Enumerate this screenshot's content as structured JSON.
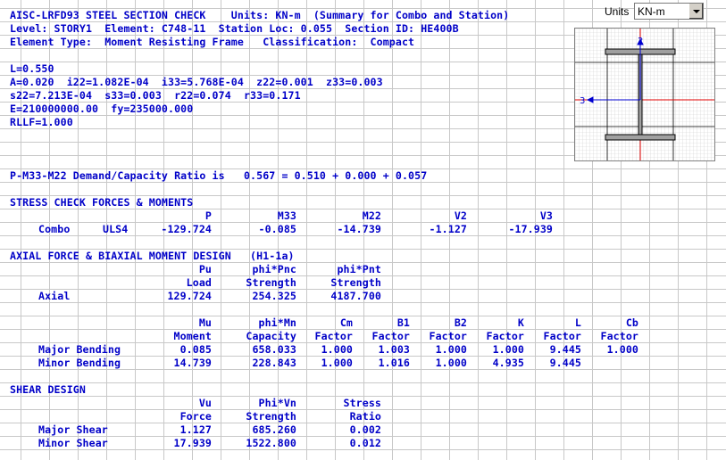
{
  "header": {
    "line1": "AISC-LRFD93 STEEL SECTION CHECK    Units: KN-m  (Summary for Combo and Station)",
    "line2": "Level: STORY1  Element: C748-11  Station Loc: 0.055  Section ID: HE400B",
    "line3": "Element Type:  Moment Resisting Frame   Classification:  Compact"
  },
  "units": {
    "label": "Units",
    "value": "KN-m"
  },
  "section_preview": {
    "axis_2": "2",
    "axis_3": "3"
  },
  "properties": [
    "L=0.550",
    "A=0.020  i22=1.082E-04  i33=5.768E-04  z22=0.001  z33=0.003",
    "s22=7.213E-04  s33=0.003  r22=0.074  r33=0.171",
    "E=210000000.00  fy=235000.000",
    "RLLF=1.000"
  ],
  "ratio_line": "P-M33-M22 Demand/Capacity Ratio is   0.567 = 0.510 + 0.000 + 0.057",
  "stress": {
    "title": "STRESS CHECK FORCES & MOMENTS",
    "headers": [
      "P",
      "M33",
      "M22",
      "V2",
      "V3"
    ],
    "row": {
      "label": "Combo",
      "combo": "ULS4",
      "values": [
        "-129.724",
        "-0.085",
        "-14.739",
        "-1.127",
        "-17.939"
      ]
    }
  },
  "axial": {
    "title": "AXIAL FORCE & BIAXIAL MOMENT DESIGN   (H1-1a)",
    "headers1": [
      "Pu",
      "phi*Pnc",
      "phi*Pnt"
    ],
    "headers2": [
      "Load",
      "Strength",
      "Strength"
    ],
    "row": {
      "label": "Axial",
      "values": [
        "129.724",
        "254.325",
        "4187.700"
      ]
    }
  },
  "moment": {
    "headers1": [
      "Mu",
      "phi*Mn",
      "Cm",
      "B1",
      "B2",
      "K",
      "L",
      "Cb"
    ],
    "headers2": [
      "Moment",
      "Capacity",
      "Factor",
      "Factor",
      "Factor",
      "Factor",
      "Factor",
      "Factor"
    ],
    "rows": [
      {
        "label": "Major Bending",
        "values": [
          "0.085",
          "658.033",
          "1.000",
          "1.003",
          "1.000",
          "1.000",
          "9.445",
          "1.000"
        ]
      },
      {
        "label": "Minor Bending",
        "values": [
          "14.739",
          "228.843",
          "1.000",
          "1.016",
          "1.000",
          "4.935",
          "9.445",
          ""
        ]
      }
    ]
  },
  "shear": {
    "title": "SHEAR DESIGN",
    "headers1": [
      "Vu",
      "Phi*Vn",
      "Stress"
    ],
    "headers2": [
      "Force",
      "Strength",
      "Ratio"
    ],
    "rows": [
      {
        "label": "Major Shear",
        "values": [
          "1.127",
          "685.260",
          "0.002"
        ]
      },
      {
        "label": "Minor Shear",
        "values": [
          "17.939",
          "1522.800",
          "0.012"
        ]
      }
    ]
  }
}
